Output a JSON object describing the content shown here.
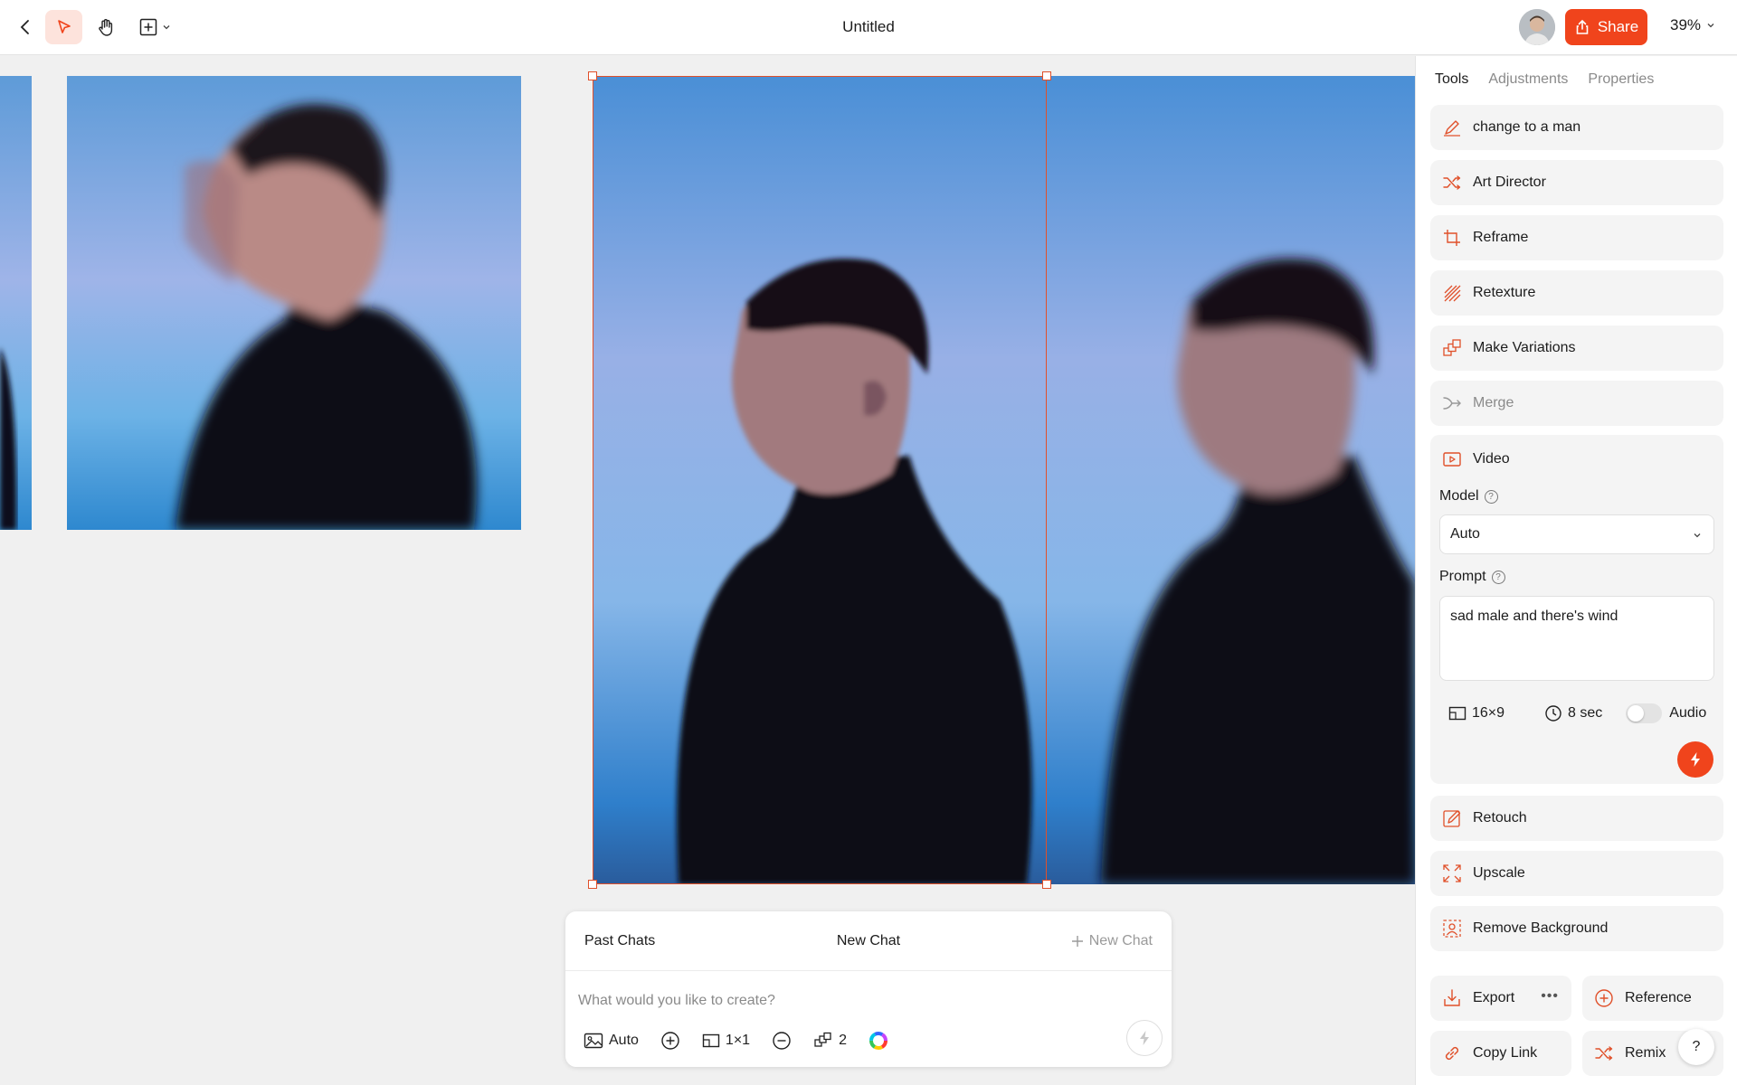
{
  "header": {
    "title": "Untitled",
    "share_label": "Share",
    "zoom": "39%"
  },
  "colors": {
    "accent": "#f0441c",
    "selection": "#e0502a",
    "panel_bg": "#f4f4f4"
  },
  "chat": {
    "past_chats": "Past Chats",
    "title": "New Chat",
    "new_chat": "New Chat",
    "placeholder": "What would you like to create?",
    "tools": {
      "mode": "Auto",
      "ratio": "1×1",
      "count": "2"
    }
  },
  "panel": {
    "tabs": [
      {
        "label": "Tools",
        "active": true
      },
      {
        "label": "Adjustments",
        "active": false
      },
      {
        "label": "Properties",
        "active": false
      }
    ],
    "tools": [
      {
        "label": "change to a man",
        "icon": "pencil-icon"
      },
      {
        "label": "Art Director",
        "icon": "shuffle-icon"
      },
      {
        "label": "Reframe",
        "icon": "crop-icon"
      },
      {
        "label": "Retexture",
        "icon": "texture-icon"
      },
      {
        "label": "Make Variations",
        "icon": "variations-icon"
      },
      {
        "label": "Merge",
        "icon": "merge-icon",
        "disabled": true
      }
    ],
    "video": {
      "label": "Video",
      "model_label": "Model",
      "model_value": "Auto",
      "prompt_label": "Prompt",
      "prompt_value": "sad male and there's wind",
      "ratio": "16×9",
      "duration": "8 sec",
      "audio_label": "Audio",
      "audio_on": false
    },
    "more_tools": [
      {
        "label": "Retouch",
        "icon": "retouch-icon"
      },
      {
        "label": "Upscale",
        "icon": "upscale-icon"
      },
      {
        "label": "Remove Background",
        "icon": "remove-bg-icon"
      }
    ],
    "footer": {
      "export": "Export",
      "reference": "Reference",
      "copy_link": "Copy Link",
      "remix": "Remix",
      "help": "?"
    }
  }
}
